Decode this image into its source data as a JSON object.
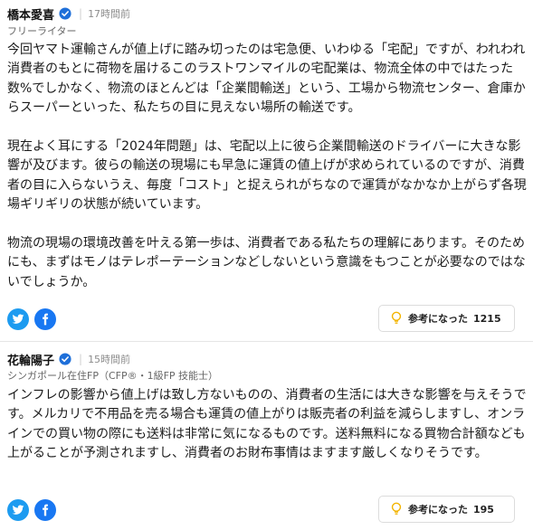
{
  "colors": {
    "verified": "#1e6fd9",
    "twitter": "#1d9bf0",
    "facebook": "#1877f2",
    "bulb": "#f3b400"
  },
  "comments": [
    {
      "author": "橋本愛喜",
      "time": "17時間前",
      "role": "フリーライター",
      "paragraphs": [
        "今回ヤマト運輸さんが値上げに踏み切ったのは宅急便、いわゆる「宅配」ですが、われわれ消費者のもとに荷物を届けるこのラストワンマイルの宅配業は、物流全体の中ではたった数%でしかなく、物流のほとんどは「企業間輸送」という、工場から物流センター、倉庫からスーパーといった、私たちの目に見えない場所の輸送です。",
        "現在よく耳にする「2024年問題」は、宅配以上に彼ら企業間輸送のドライバーに大きな影響が及びます。彼らの輸送の現場にも早急に運賃の値上げが求められているのですが、消費者の目に入らないうえ、毎度「コスト」と捉えられがちなので運賃がなかなか上がらず各現場ギリギリの状態が続いています。",
        "物流の現場の環境改善を叶える第一歩は、消費者である私たちの理解にあります。そのためにも、まずはモノはテレポーテーションなどしないという意識をもつことが必要なのではないでしょうか。"
      ],
      "helpful_label": "参考になった",
      "helpful_count": "1215"
    },
    {
      "author": "花輪陽子",
      "time": "15時間前",
      "role": "シンガポール在住FP（CFP®・1級FP 技能士）",
      "paragraphs": [
        "インフレの影響から値上げは致し方ないものの、消費者の生活には大きな影響を与えそうです。メルカリで不用品を売る場合も運賃の値上がりは販売者の利益を減らしますし、オンラインでの買い物の際にも送料は非常に気になるものです。送料無料になる買物合計額なども上がることが予測されますし、消費者のお財布事情はますます厳しくなりそうです。"
      ],
      "helpful_label": "参考になった",
      "helpful_count": "195"
    }
  ]
}
